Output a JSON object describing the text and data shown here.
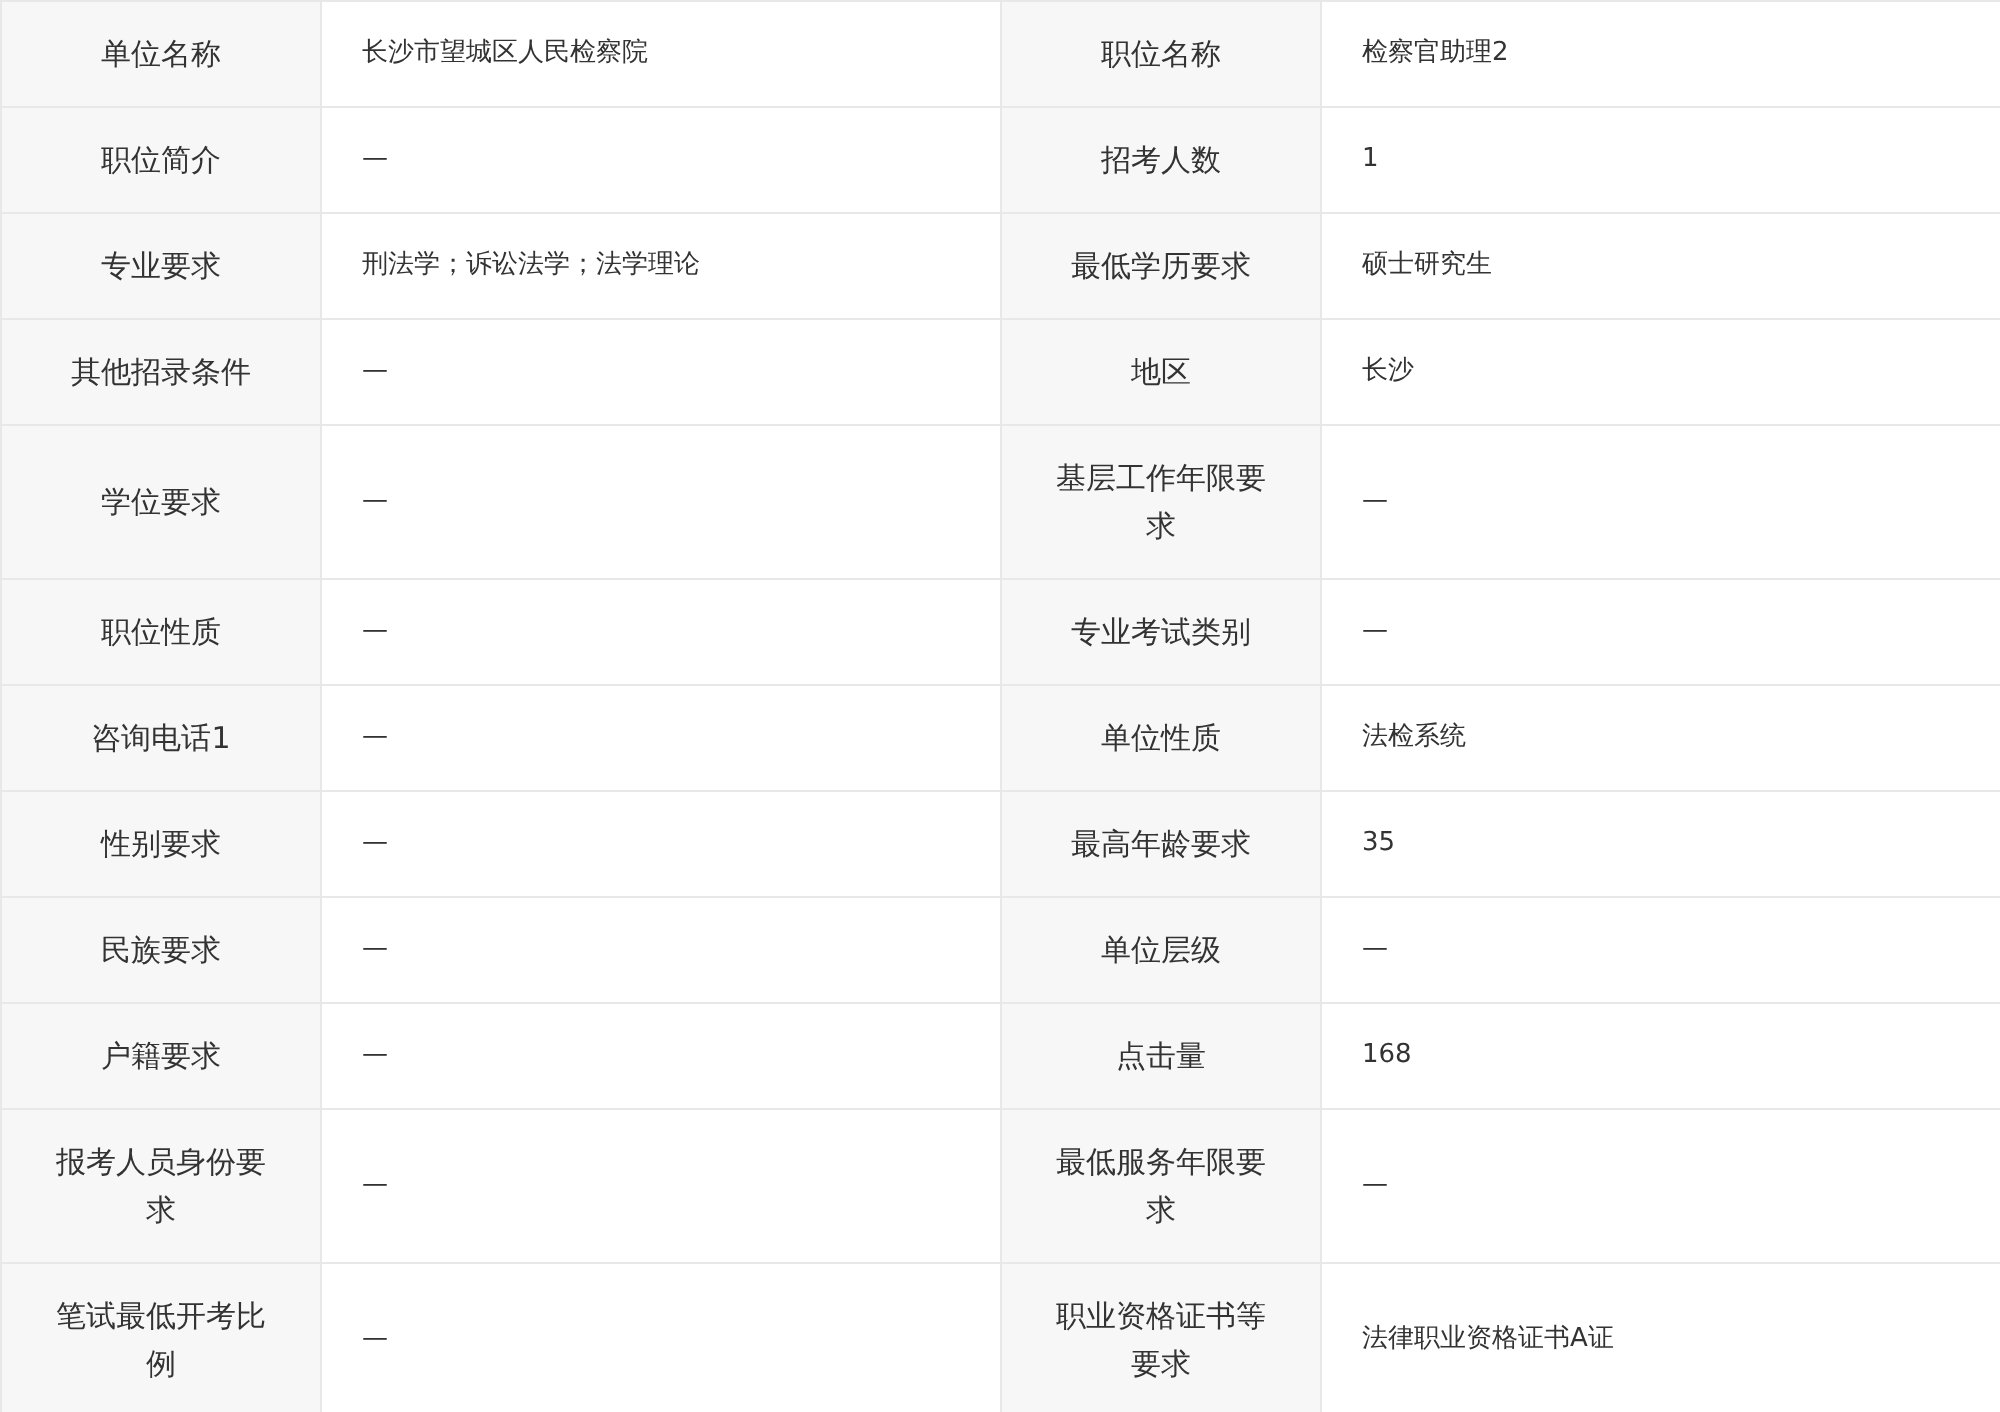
{
  "rows": [
    {
      "label_1": "单位名称",
      "value_1": "长沙市望城区人民检察院",
      "label_2": "职位名称",
      "value_2": "检察官助理2"
    },
    {
      "label_1": "职位简介",
      "value_1": "—",
      "label_2": "招考人数",
      "value_2": "1"
    },
    {
      "label_1": "专业要求",
      "value_1": "刑法学；诉讼法学；法学理论",
      "label_2": "最低学历要求",
      "value_2": "硕士研究生"
    },
    {
      "label_1": "其他招录条件",
      "value_1": "—",
      "label_2": "地区",
      "value_2": "长沙"
    },
    {
      "label_1": "学位要求",
      "value_1": "—",
      "label_2": "基层工作年限要求",
      "value_2": "—"
    },
    {
      "label_1": "职位性质",
      "value_1": "—",
      "label_2": "专业考试类别",
      "value_2": "—"
    },
    {
      "label_1": "咨询电话1",
      "value_1": "—",
      "label_2": "单位性质",
      "value_2": "法检系统"
    },
    {
      "label_1": "性别要求",
      "value_1": "—",
      "label_2": "最高年龄要求",
      "value_2": "35"
    },
    {
      "label_1": "民族要求",
      "value_1": "—",
      "label_2": "单位层级",
      "value_2": "—"
    },
    {
      "label_1": "户籍要求",
      "value_1": "—",
      "label_2": "点击量",
      "value_2": "168"
    },
    {
      "label_1": "报考人员身份要求",
      "value_1": "—",
      "label_2": "最低服务年限要求",
      "value_2": "—"
    },
    {
      "label_1": "笔试最低开考比例",
      "value_1": "—",
      "label_2": "职业资格证书等要求",
      "value_2": "法律职业资格证书A证"
    }
  ]
}
